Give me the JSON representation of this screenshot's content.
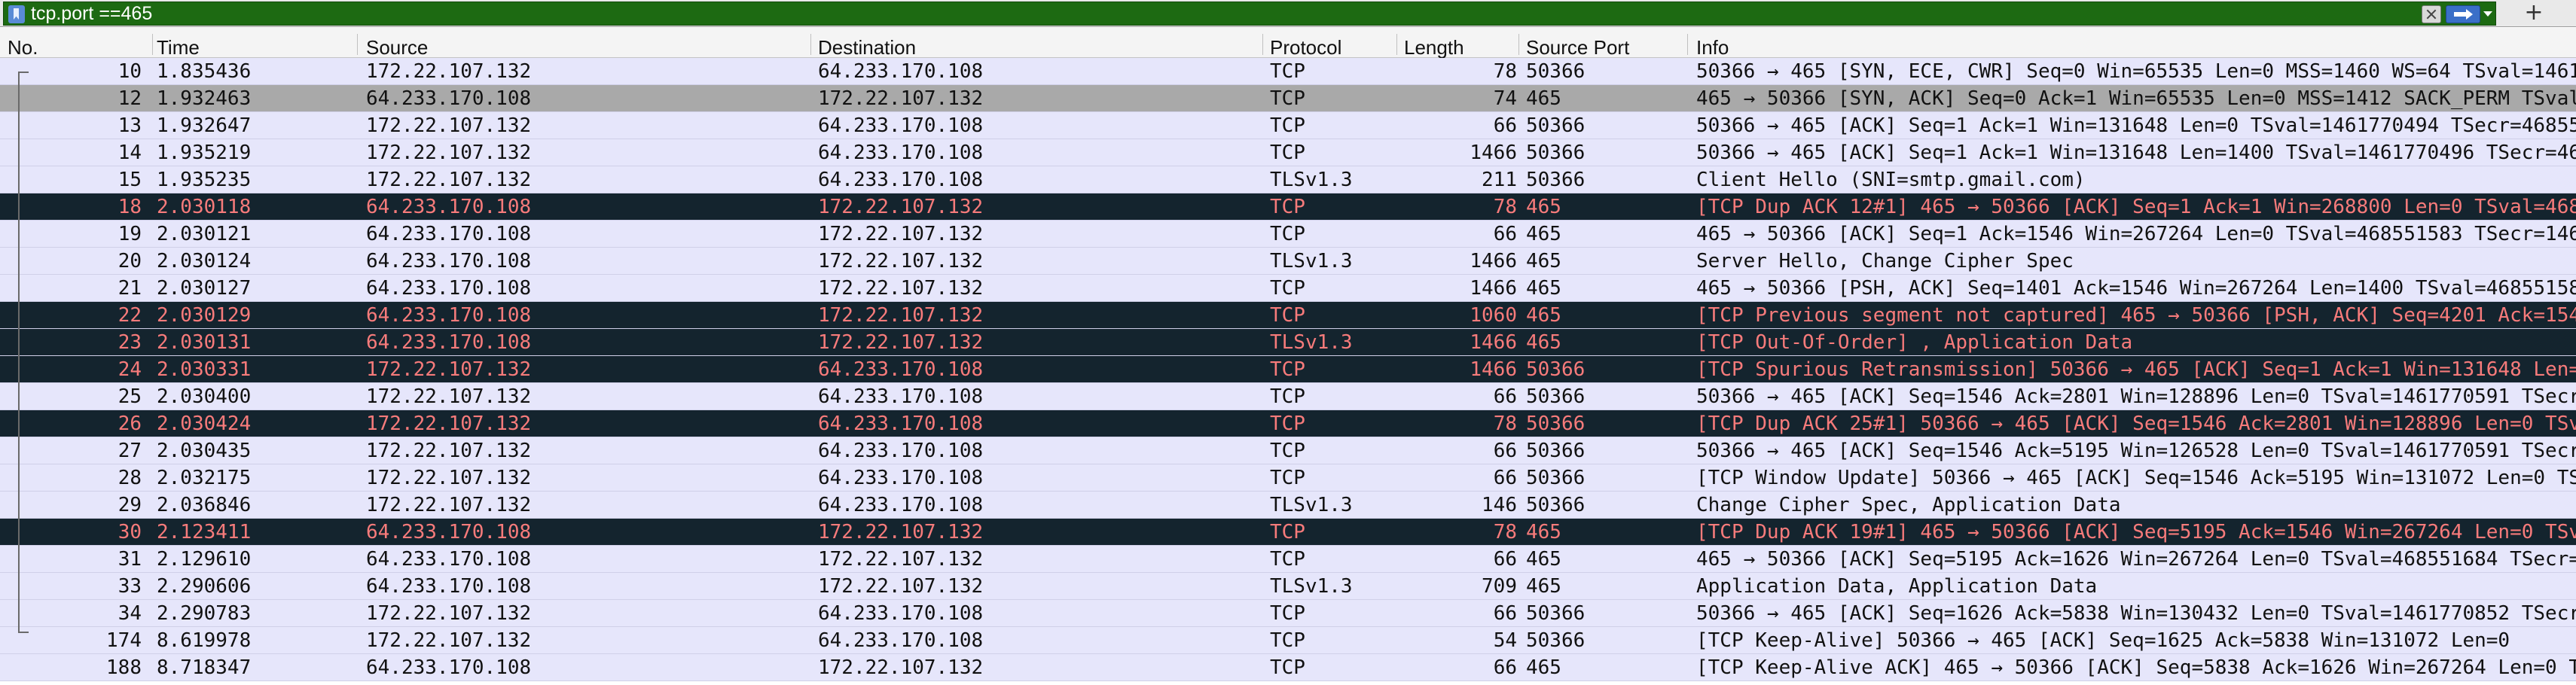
{
  "filter": {
    "value": "tcp.port ==465",
    "bookmark_icon": "bookmark-icon",
    "clear_icon": "clear-icon",
    "apply_icon": "apply-arrow-icon",
    "add_label": "+",
    "bg_color": "#1d6a12"
  },
  "columns": [
    "No.",
    "Time",
    "Source",
    "Destination",
    "Protocol",
    "Length",
    "Source Port",
    "Info"
  ],
  "rows": [
    {
      "no": "10",
      "time": "1.835436",
      "src": "172.22.107.132",
      "dst": "64.233.170.108",
      "proto": "TCP",
      "len": "78",
      "sport": "50366",
      "info": "50366 → 465 [SYN, ECE, CWR] Seq=0 Win=65535 Len=0 MSS=1460 WS=64 TSval=1461",
      "style": "normal"
    },
    {
      "no": "12",
      "time": "1.932463",
      "src": "64.233.170.108",
      "dst": "172.22.107.132",
      "proto": "TCP",
      "len": "74",
      "sport": "465",
      "info": "465 → 50366 [SYN, ACK] Seq=0 Ack=1 Win=65535 Len=0 MSS=1412 SACK_PERM TSval",
      "style": "selected"
    },
    {
      "no": "13",
      "time": "1.932647",
      "src": "172.22.107.132",
      "dst": "64.233.170.108",
      "proto": "TCP",
      "len": "66",
      "sport": "50366",
      "info": "50366 → 465 [ACK] Seq=1 Ack=1 Win=131648 Len=0 TSval=1461770494 TSecr=46855",
      "style": "normal"
    },
    {
      "no": "14",
      "time": "1.935219",
      "src": "172.22.107.132",
      "dst": "64.233.170.108",
      "proto": "TCP",
      "len": "1466",
      "sport": "50366",
      "info": "50366 → 465 [ACK] Seq=1 Ack=1 Win=131648 Len=1400 TSval=1461770496 TSecr=46",
      "style": "normal"
    },
    {
      "no": "15",
      "time": "1.935235",
      "src": "172.22.107.132",
      "dst": "64.233.170.108",
      "proto": "TLSv1.3",
      "len": "211",
      "sport": "50366",
      "info": "Client Hello (SNI=smtp.gmail.com)",
      "style": "normal"
    },
    {
      "no": "18",
      "time": "2.030118",
      "src": "64.233.170.108",
      "dst": "172.22.107.132",
      "proto": "TCP",
      "len": "78",
      "sport": "465",
      "info": "[TCP Dup ACK 12#1] 465 → 50366 [ACK] Seq=1 Ack=1 Win=268800 Len=0 TSval=468",
      "style": "bad"
    },
    {
      "no": "19",
      "time": "2.030121",
      "src": "64.233.170.108",
      "dst": "172.22.107.132",
      "proto": "TCP",
      "len": "66",
      "sport": "465",
      "info": "465 → 50366 [ACK] Seq=1 Ack=1546 Win=267264 Len=0 TSval=468551583 TSecr=146",
      "style": "normal"
    },
    {
      "no": "20",
      "time": "2.030124",
      "src": "64.233.170.108",
      "dst": "172.22.107.132",
      "proto": "TLSv1.3",
      "len": "1466",
      "sport": "465",
      "info": "Server Hello, Change Cipher Spec",
      "style": "normal"
    },
    {
      "no": "21",
      "time": "2.030127",
      "src": "64.233.170.108",
      "dst": "172.22.107.132",
      "proto": "TCP",
      "len": "1466",
      "sport": "465",
      "info": "465 → 50366 [PSH, ACK] Seq=1401 Ack=1546 Win=267264 Len=1400 TSval=46855158",
      "style": "normal"
    },
    {
      "no": "22",
      "time": "2.030129",
      "src": "64.233.170.108",
      "dst": "172.22.107.132",
      "proto": "TCP",
      "len": "1060",
      "sport": "465",
      "info": "[TCP Previous segment not captured] 465 → 50366 [PSH, ACK] Seq=4201 Ack=154",
      "style": "bad"
    },
    {
      "no": "23",
      "time": "2.030131",
      "src": "64.233.170.108",
      "dst": "172.22.107.132",
      "proto": "TLSv1.3",
      "len": "1466",
      "sport": "465",
      "info": "[TCP Out-Of-Order] , Application Data",
      "style": "bad"
    },
    {
      "no": "24",
      "time": "2.030331",
      "src": "172.22.107.132",
      "dst": "64.233.170.108",
      "proto": "TCP",
      "len": "1466",
      "sport": "50366",
      "info": "[TCP Spurious Retransmission] 50366 → 465 [ACK] Seq=1 Ack=1 Win=131648 Len=",
      "style": "bad"
    },
    {
      "no": "25",
      "time": "2.030400",
      "src": "172.22.107.132",
      "dst": "64.233.170.108",
      "proto": "TCP",
      "len": "66",
      "sport": "50366",
      "info": "50366 → 465 [ACK] Seq=1546 Ack=2801 Win=128896 Len=0 TSval=1461770591 TSecr",
      "style": "normal"
    },
    {
      "no": "26",
      "time": "2.030424",
      "src": "172.22.107.132",
      "dst": "64.233.170.108",
      "proto": "TCP",
      "len": "78",
      "sport": "50366",
      "info": "[TCP Dup ACK 25#1] 50366 → 465 [ACK] Seq=1546 Ack=2801 Win=128896 Len=0 TSv",
      "style": "bad"
    },
    {
      "no": "27",
      "time": "2.030435",
      "src": "172.22.107.132",
      "dst": "64.233.170.108",
      "proto": "TCP",
      "len": "66",
      "sport": "50366",
      "info": "50366 → 465 [ACK] Seq=1546 Ack=5195 Win=126528 Len=0 TSval=1461770591 TSecr",
      "style": "normal"
    },
    {
      "no": "28",
      "time": "2.032175",
      "src": "172.22.107.132",
      "dst": "64.233.170.108",
      "proto": "TCP",
      "len": "66",
      "sport": "50366",
      "info": "[TCP Window Update] 50366 → 465 [ACK] Seq=1546 Ack=5195 Win=131072 Len=0 TS",
      "style": "normal"
    },
    {
      "no": "29",
      "time": "2.036846",
      "src": "172.22.107.132",
      "dst": "64.233.170.108",
      "proto": "TLSv1.3",
      "len": "146",
      "sport": "50366",
      "info": "Change Cipher Spec, Application Data",
      "style": "normal"
    },
    {
      "no": "30",
      "time": "2.123411",
      "src": "64.233.170.108",
      "dst": "172.22.107.132",
      "proto": "TCP",
      "len": "78",
      "sport": "465",
      "info": "[TCP Dup ACK 19#1] 465 → 50366 [ACK] Seq=5195 Ack=1546 Win=267264 Len=0 TSv",
      "style": "bad"
    },
    {
      "no": "31",
      "time": "2.129610",
      "src": "64.233.170.108",
      "dst": "172.22.107.132",
      "proto": "TCP",
      "len": "66",
      "sport": "465",
      "info": "465 → 50366 [ACK] Seq=5195 Ack=1626 Win=267264 Len=0 TSval=468551684 TSecr=",
      "style": "normal"
    },
    {
      "no": "33",
      "time": "2.290606",
      "src": "64.233.170.108",
      "dst": "172.22.107.132",
      "proto": "TLSv1.3",
      "len": "709",
      "sport": "465",
      "info": "Application Data, Application Data",
      "style": "normal"
    },
    {
      "no": "34",
      "time": "2.290783",
      "src": "172.22.107.132",
      "dst": "64.233.170.108",
      "proto": "TCP",
      "len": "66",
      "sport": "50366",
      "info": "50366 → 465 [ACK] Seq=1626 Ack=5838 Win=130432 Len=0 TSval=1461770852 TSecr",
      "style": "normal"
    },
    {
      "no": "174",
      "time": "8.619978",
      "src": "172.22.107.132",
      "dst": "64.233.170.108",
      "proto": "TCP",
      "len": "54",
      "sport": "50366",
      "info": "[TCP Keep-Alive] 50366 → 465 [ACK] Seq=1625 Ack=5838 Win=131072 Len=0",
      "style": "normal"
    },
    {
      "no": "188",
      "time": "8.718347",
      "src": "64.233.170.108",
      "dst": "172.22.107.132",
      "proto": "TCP",
      "len": "66",
      "sport": "465",
      "info": "[TCP Keep-Alive ACK] 465 → 50366 [ACK] Seq=5838 Ack=1626 Win=267264 Len=0 TS",
      "style": "normal"
    }
  ],
  "colors": {
    "row_normal_bg": "#e6e6fb",
    "row_selected_bg": "#a9a9a9",
    "row_bad_bg": "#14242e",
    "row_bad_text": "#f77b7b"
  }
}
